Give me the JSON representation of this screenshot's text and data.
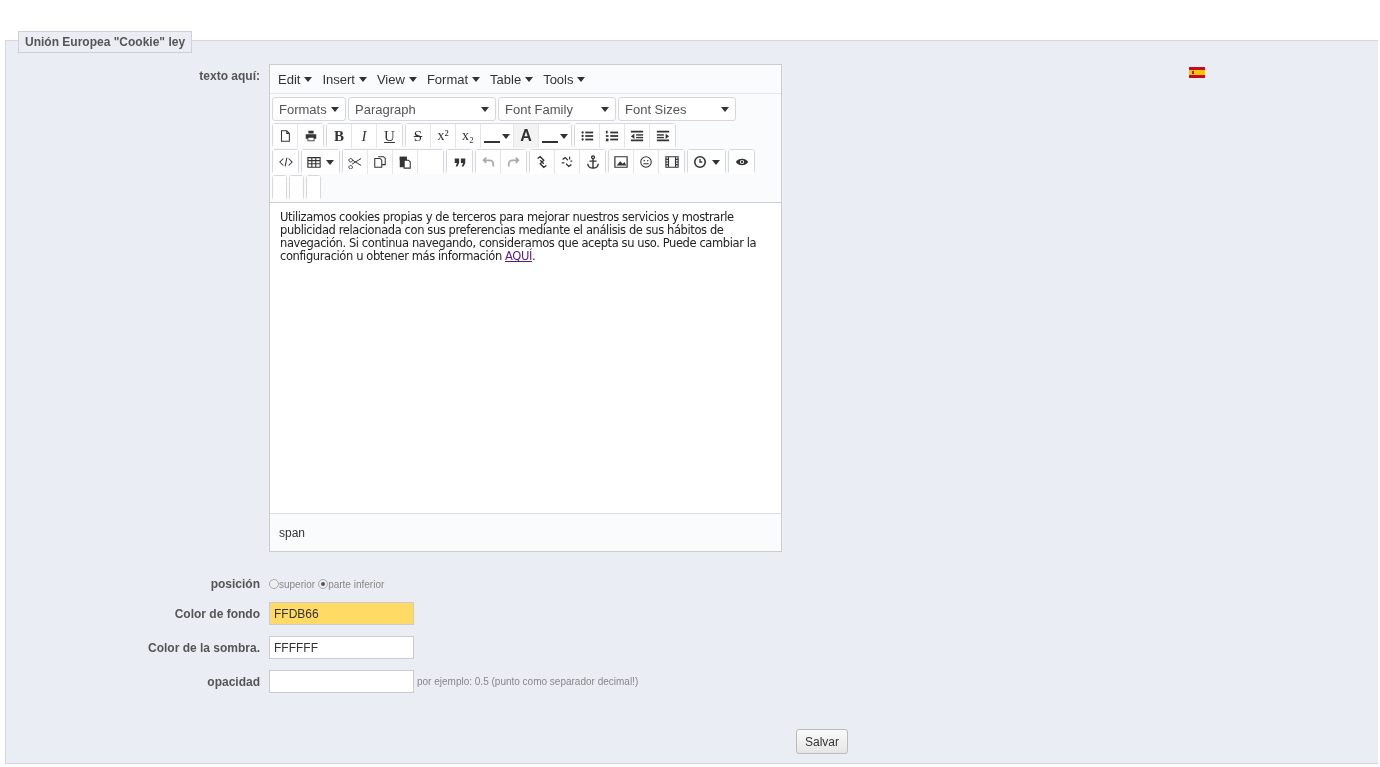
{
  "fieldset": {
    "legend": "Unión Europea \"Cookie\" ley"
  },
  "editor": {
    "label": "texto aquí:",
    "menus": [
      "Edit",
      "Insert",
      "View",
      "Format",
      "Table",
      "Tools"
    ],
    "selects": [
      "Formats",
      "Paragraph",
      "Font Family",
      "Font Sizes"
    ],
    "glyphs": [
      "B",
      "I",
      "U",
      "S",
      "x²",
      "x₂",
      "A"
    ],
    "content": "Utilizamos cookies propias y de terceros para mejorar nuestros servicios y mostrarle publicidad relacionada con sus preferencias mediante el análisis de sus hábitos de navegación. Si continua navegando, consideramos que acepta su uso. Puede cambiar la configuración u obtener más información",
    "link": "AQUÍ",
    "content_end": ".",
    "path": "span"
  },
  "position": {
    "label": "posición",
    "options": [
      {
        "label": "superior",
        "selected": false
      },
      {
        "label": "parte inferior",
        "selected": true
      }
    ]
  },
  "fields": [
    {
      "label": "Color de fondo",
      "value": "FFDB66",
      "color": "#ffdb66"
    },
    {
      "label": "Color de la sombra.",
      "value": "FFFFFF",
      "color": "#ffffff"
    },
    {
      "label": "opacidad",
      "hint": "por ejemplo: 0.5 (punto como separador decimal!)"
    }
  ],
  "save": "Salvar"
}
